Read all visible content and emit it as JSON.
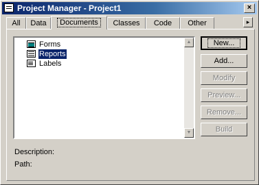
{
  "window": {
    "title": "Project Manager - Project1",
    "close_glyph": "×"
  },
  "tabs": [
    {
      "label": "All",
      "active": false
    },
    {
      "label": "Data",
      "active": false
    },
    {
      "label": "Documents",
      "active": true
    },
    {
      "label": "Classes",
      "active": false
    },
    {
      "label": "Code",
      "active": false
    },
    {
      "label": "Other",
      "active": false
    }
  ],
  "tab_scroll_glyph": "▸",
  "tree": {
    "items": [
      {
        "label": "Forms",
        "icon": "form-icon",
        "selected": false
      },
      {
        "label": "Reports",
        "icon": "report-icon",
        "selected": true
      },
      {
        "label": "Labels",
        "icon": "label-icon",
        "selected": false
      }
    ]
  },
  "scrollbar": {
    "up_glyph": "▲",
    "down_glyph": "▼"
  },
  "buttons": {
    "new": "New...",
    "add": "Add...",
    "modify": "Modify",
    "preview": "Preview...",
    "remove": "Remove...",
    "build": "Build"
  },
  "info": {
    "description_label": "Description:",
    "path_label": "Path:"
  },
  "colors": {
    "title_bar": "#0a246a",
    "selection": "#0a246a",
    "face": "#d4d0c8"
  }
}
